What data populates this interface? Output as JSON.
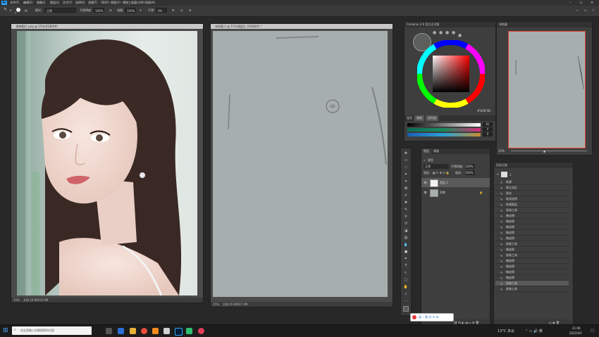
{
  "menu": {
    "items": [
      "文件(F)",
      "编辑(E)",
      "图像(I)",
      "图层(L)",
      "文字(Y)",
      "选择(S)",
      "滤镜(T)",
      "3D(D)",
      "视图(V)",
      "增效工具",
      "窗口(W)",
      "帮助(H)"
    ],
    "logo": "Ps"
  },
  "options": {
    "mode_label": "模式:",
    "mode_value": "正常",
    "opacity_label": "不透明度:",
    "opacity_value": "100%",
    "flow_label": "流量:",
    "flow_value": "100%",
    "smooth_label": "平滑:",
    "smooth_value": "0%",
    "brush_size": "2"
  },
  "photo_doc": {
    "title": " 微博图片.png @ 15%(RGB/8#)",
    "status": "文档:16.9M/16.9M",
    "zoom": "15%"
  },
  "canvas_doc": {
    "title": "未标题-1 @ 15%(图层1, RGB/8#) *",
    "status": "文档:16.4M/27.4M",
    "zoom": "15%"
  },
  "color_panel": {
    "title": "Coolorus 2.6 官方正式版",
    "tabs": [
      "混合",
      "通道",
      "混色器"
    ],
    "hex": "#5A5F5D",
    "slider_values": [
      "81",
      "0",
      "0"
    ]
  },
  "navigator": {
    "title": "导航器",
    "zoom": "15%"
  },
  "layers": {
    "tabs": [
      "图层",
      "通道"
    ],
    "kind": "类型",
    "blend": "正常",
    "opacity_label": "不透明度:",
    "opacity": "100%",
    "lock_label": "锁定:",
    "fill_label": "填充:",
    "fill": "100%",
    "items": [
      {
        "name": "图层 1"
      },
      {
        "name": "背景"
      }
    ]
  },
  "history": {
    "title": "历史记录",
    "snapshot": "1",
    "items": [
      "新建",
      "建立选区",
      "填充",
      "取消选择",
      "新建图层",
      "画笔工具",
      "橡皮擦",
      "橡皮擦",
      "橡皮擦",
      "橡皮擦",
      "橡皮擦",
      "画笔工具",
      "橡皮擦",
      "画笔工具",
      "橡皮擦",
      "橡皮擦",
      "橡皮擦",
      "橡皮擦",
      "画笔工具",
      "画笔工具"
    ]
  },
  "taskbar": {
    "search_placeholder": "在这里输入你要搜索的内容",
    "weather": "13°C 多云",
    "time": "21:06",
    "date": "2022/4/1",
    "im_text": "英 ∘ 简 ☺ ☷ ⚙"
  },
  "colors": {
    "accent": "#31a8ff",
    "canvas": "#a7afae",
    "fg": "#5a5f5d",
    "bg": "#ffffff"
  }
}
